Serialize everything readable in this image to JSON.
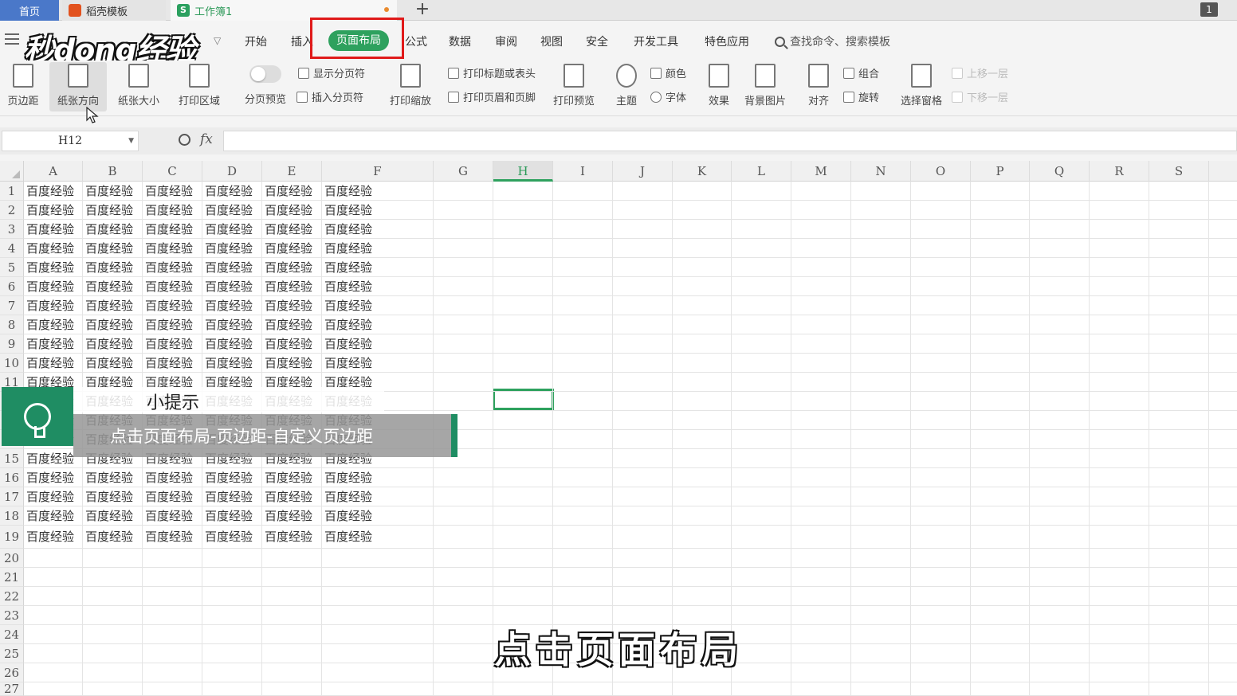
{
  "tabs": {
    "home": "首页",
    "template": "稻壳模板",
    "workbook": "工作簿1",
    "add": "+",
    "badge": "1"
  },
  "logo": "秒dong经验",
  "menu": {
    "items": [
      "开始",
      "插入",
      "页面布局",
      "公式",
      "数据",
      "审阅",
      "视图",
      "安全",
      "开发工具",
      "特色应用"
    ],
    "active": "页面布局",
    "search": "查找命令、搜索模板"
  },
  "ribbon": {
    "margins": "页边距",
    "orientation": "纸张方向",
    "size": "纸张大小",
    "print_area": "打印区域",
    "page_break_preview": "分页预览",
    "show_page_break": "显示分页符",
    "insert_page_break": "插入分页符",
    "print_scale": "打印缩放",
    "print_titles": "打印标题或表头",
    "print_header_footer": "打印页眉和页脚",
    "print_preview": "打印预览",
    "theme": "主题",
    "colors": "颜色",
    "fonts": "字体",
    "effects": "效果",
    "background": "背景图片",
    "align": "对齐",
    "group": "组合",
    "rotate": "旋转",
    "selection_pane": "选择窗格",
    "bring_forward": "上移一层",
    "send_backward": "下移一层"
  },
  "formula_bar": {
    "name_box": "H12",
    "fx": "fx",
    "value": ""
  },
  "grid": {
    "columns": [
      "A",
      "B",
      "C",
      "D",
      "E",
      "F",
      "G",
      "H",
      "I",
      "J",
      "K",
      "L",
      "M",
      "N",
      "O",
      "P",
      "Q",
      "R",
      "S"
    ],
    "active_column": "H",
    "rows": [
      "1",
      "2",
      "3",
      "4",
      "5",
      "6",
      "7",
      "8",
      "9",
      "10",
      "11",
      "12",
      "13",
      "14",
      "15",
      "16",
      "17",
      "18",
      "19",
      "20",
      "21",
      "22",
      "23",
      "24",
      "25",
      "26",
      "27"
    ],
    "cell_text": "百度经验",
    "filled_rows": 19,
    "filled_cols": 6,
    "selected_cell": "H12"
  },
  "tip": {
    "title": "小提示",
    "text": "点击页面布局-页边距-自定义页边距"
  },
  "caption": "点击页面布局",
  "colors": {
    "accent": "#2ea15e",
    "highlight": "#e01a1a",
    "home_tab": "#4a78c9"
  }
}
